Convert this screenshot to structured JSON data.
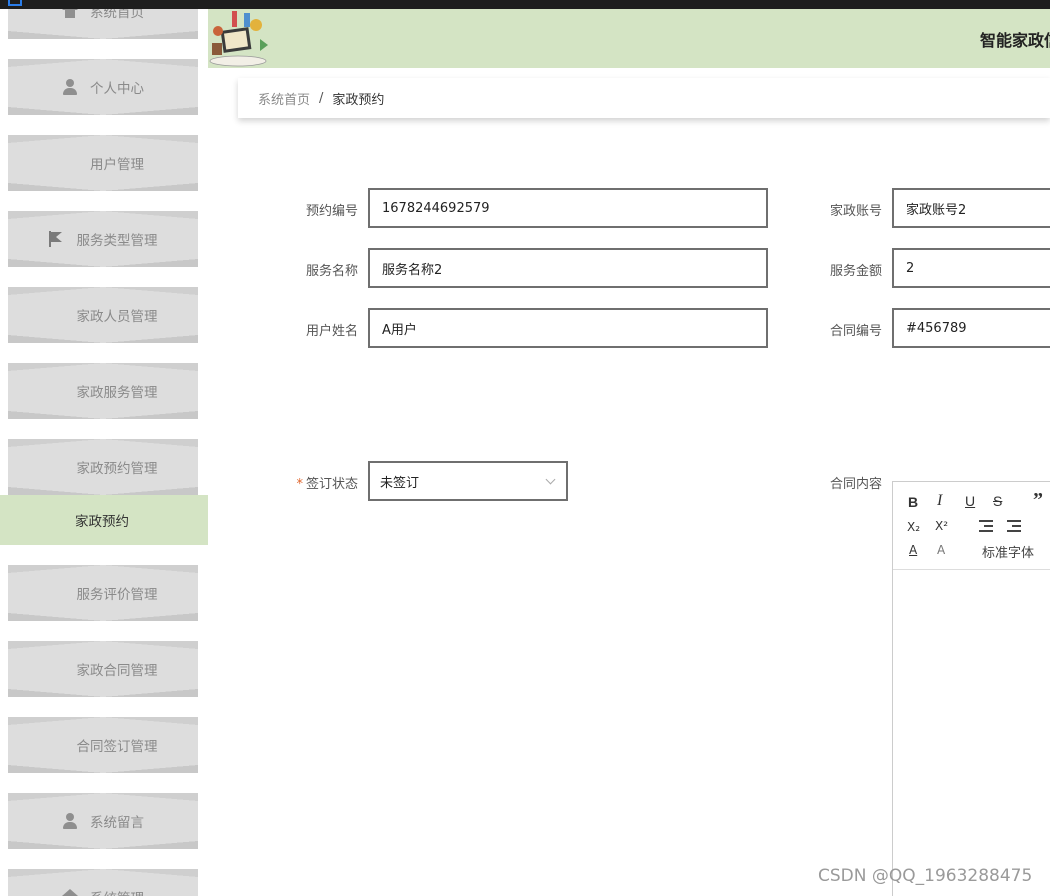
{
  "sidebar": {
    "items": [
      {
        "label": "系统首页",
        "icon": "home-icon"
      },
      {
        "label": "个人中心",
        "icon": "user-icon"
      },
      {
        "label": "用户管理",
        "icon": "grid-icon"
      },
      {
        "label": "服务类型管理",
        "icon": "flag-icon"
      },
      {
        "label": "家政人员管理",
        "icon": "grid-icon"
      },
      {
        "label": "家政服务管理",
        "icon": "grid-icon"
      },
      {
        "label": "家政预约管理",
        "icon": "grid-icon"
      },
      {
        "label": "服务评价管理",
        "icon": "grid-icon"
      },
      {
        "label": "家政合同管理",
        "icon": "grid-icon"
      },
      {
        "label": "合同签订管理",
        "icon": "grid-icon"
      },
      {
        "label": "系统留言",
        "icon": "user-icon"
      },
      {
        "label": "系统管理",
        "icon": "gear-icon"
      }
    ],
    "active_sub_item": "家政预约"
  },
  "header": {
    "site_title": "智能家政信"
  },
  "breadcrumb": {
    "home": "系统首页",
    "separator": "/",
    "current": "家政预约"
  },
  "form": {
    "booking_no": {
      "label": "预约编号",
      "value": "1678244692579"
    },
    "housekeeping_account": {
      "label": "家政账号",
      "value": "家政账号2"
    },
    "service_name": {
      "label": "服务名称",
      "value": "服务名称2"
    },
    "service_amount": {
      "label": "服务金额",
      "value": "2"
    },
    "user_name": {
      "label": "用户姓名",
      "value": "A用户"
    },
    "contract_no": {
      "label": "合同编号",
      "value": "#456789"
    },
    "sign_status": {
      "label": "签订状态",
      "required_mark": "*",
      "value": "未签订"
    },
    "contract_content": {
      "label": "合同内容"
    }
  },
  "editor": {
    "bold": "B",
    "italic": "I",
    "underline": "U",
    "strike": "S",
    "quote": "”",
    "subscript": "X₂",
    "superscript": "X²",
    "font_color": "A",
    "bg_color": "A",
    "font_family": "标准字体"
  },
  "watermark": "CSDN @QQ_1963288475"
}
